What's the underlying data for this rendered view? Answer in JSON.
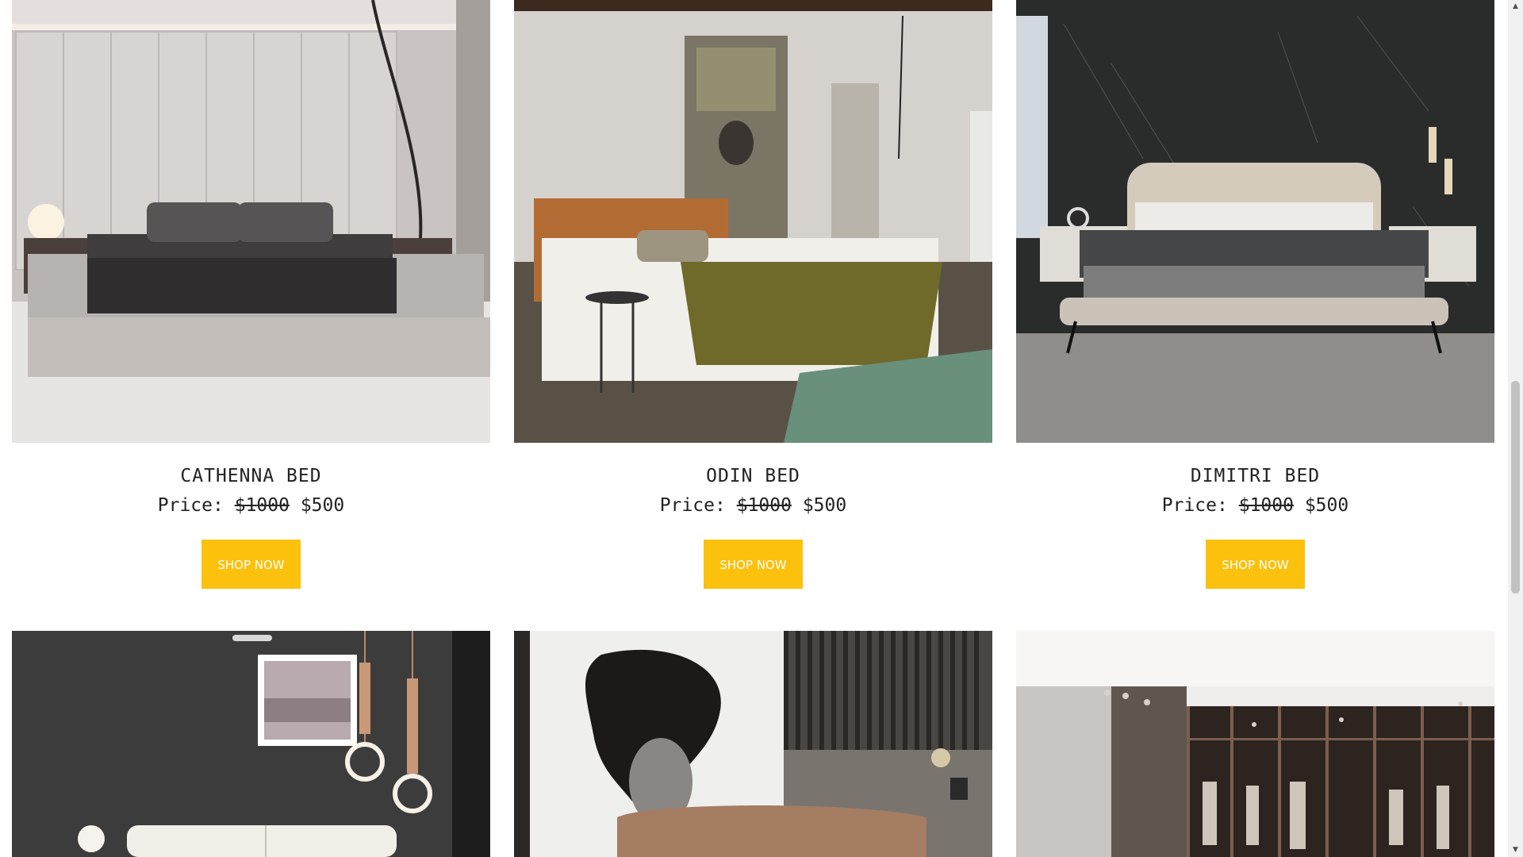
{
  "products": [
    {
      "name": "CATHENNA BED",
      "price_label": "Price:",
      "old_price": "$1000",
      "new_price": "$500",
      "button": "SHOP NOW",
      "image": "bedroom-photo-grey-platform-bed"
    },
    {
      "name": "ODIN BED",
      "price_label": "Price:",
      "old_price": "$1000",
      "new_price": "$500",
      "button": "SHOP NOW",
      "image": "bedroom-photo-leather-headboard-bed"
    },
    {
      "name": "DIMITRI BED",
      "price_label": "Price:",
      "old_price": "$1000",
      "new_price": "$500",
      "button": "SHOP NOW",
      "image": "bedroom-photo-black-marble-wall-bed"
    }
  ],
  "next_row_images": [
    "bedroom-photo-pendant-rings",
    "bedroom-photo-ink-portrait-mural",
    "bedroom-photo-walk-in-wardrobe"
  ],
  "colors": {
    "button": "#fbc10d",
    "button_text": "#ffffff",
    "text": "#222222"
  },
  "scrollbar": {
    "up_arrow": "▲",
    "down_arrow": "▼"
  }
}
